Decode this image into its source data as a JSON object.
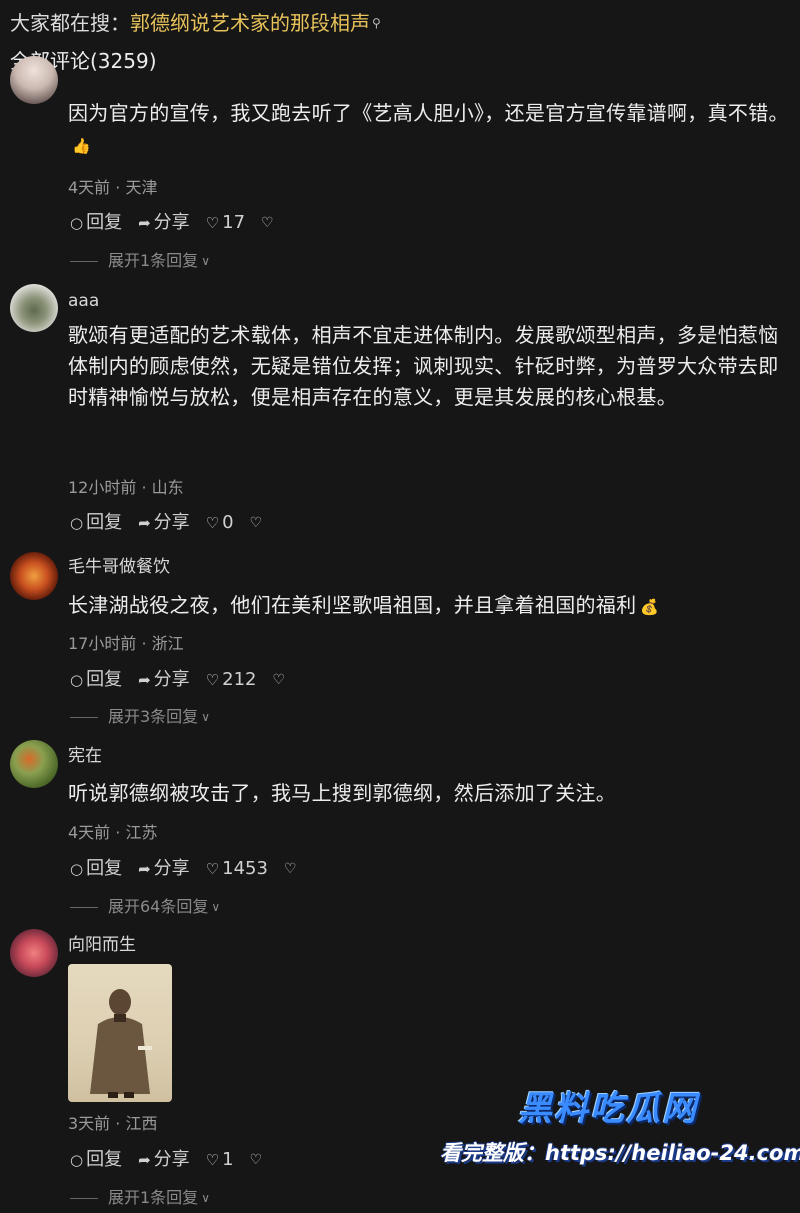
{
  "header": {
    "prefix": "大家都在搜：",
    "query": "郭德纲说艺术家的那段相声",
    "all_comments": "全部评论(3259)"
  },
  "comments": [
    {
      "username": "",
      "text": "因为官方的宣传，我又跑去听了《艺高人胆小》，还是官方宣传靠谱啊，真不错。",
      "emoji": "👍",
      "time_location": "4天前 · 天津",
      "reply_label": "回复",
      "share_label": "分享",
      "likes": "17",
      "expand": "展开1条回复"
    },
    {
      "username": "aaa",
      "text": "歌颂有更适配的艺术载体，相声不宜走进体制内。发展歌颂型相声，多是怕惹恼体制内的顾虑使然，无疑是错位发挥；讽刺现实、针砭时弊，为普罗大众带去即时精神愉悦与放松，便是相声存在的意义，更是其发展的核心根基。",
      "time_location": "12小时前 · 山东",
      "reply_label": "回复",
      "share_label": "分享",
      "likes": "0"
    },
    {
      "username": "毛牛哥做餐饮",
      "text": "长津湖战役之夜，他们在美利坚歌唱祖国，并且拿着祖国的福利",
      "emoji": "💰",
      "time_location": "17小时前 · 浙江",
      "reply_label": "回复",
      "share_label": "分享",
      "likes": "212",
      "expand": "展开3条回复"
    },
    {
      "username": "宪在",
      "text": "听说郭德纲被攻击了，我马上搜到郭德纲，然后添加了关注。",
      "time_location": "4天前 · 江苏",
      "reply_label": "回复",
      "share_label": "分享",
      "likes": "1453",
      "expand": "展开64条回复"
    },
    {
      "username": "向阳而生",
      "time_location": "3天前 · 江西",
      "reply_label": "回复",
      "share_label": "分享",
      "likes": "1",
      "expand": "展开1条回复"
    }
  ],
  "icons": {
    "reply": "comment-bubble-icon",
    "share": "share-arrow-icon",
    "like": "heart-icon",
    "dislike": "broken-heart-icon",
    "search": "search-icon"
  },
  "watermark": {
    "title": "黑料吃瓜网",
    "subtitle": "看完整版：https://heiliao-24.com"
  },
  "colors": {
    "background": "#161616",
    "search_query": "#e8c25a",
    "watermark_blue": "#3a8bff"
  }
}
